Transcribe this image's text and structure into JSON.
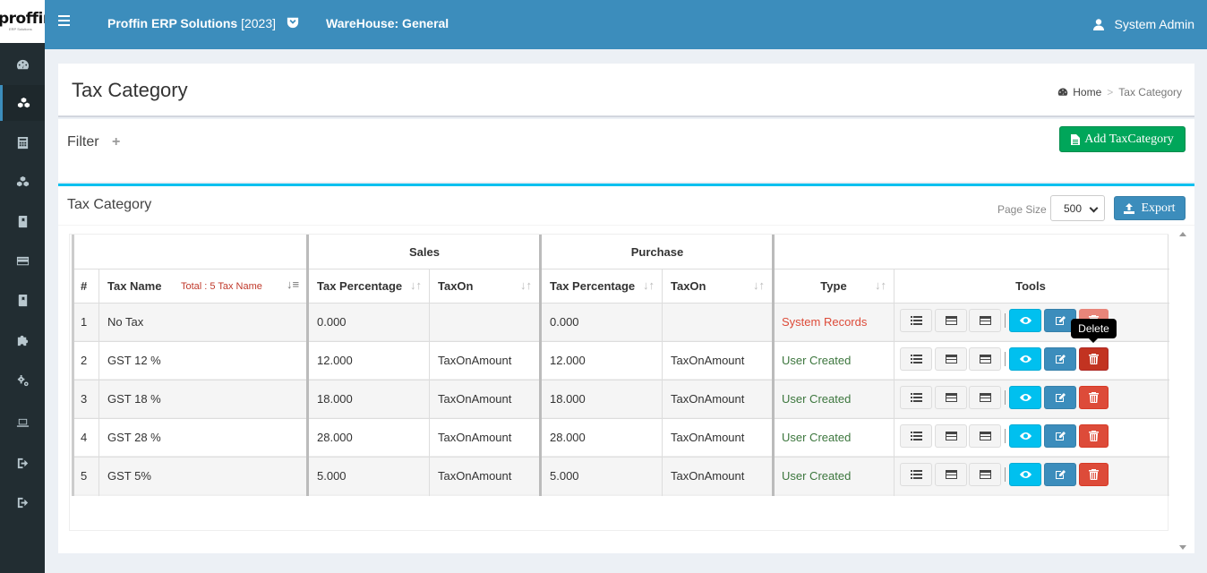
{
  "brand": {
    "logo_text": "proffin",
    "logo_sub": "ERP Solutions"
  },
  "topbar": {
    "app_title": "Proffin ERP Solutions",
    "app_year": "[2023]",
    "warehouse": "WareHouse: General",
    "user": "System Admin"
  },
  "sidebar": {
    "items": [
      {
        "icon": "dashboard-icon"
      },
      {
        "icon": "cubes-icon",
        "active": true
      },
      {
        "icon": "calculator-icon"
      },
      {
        "icon": "cubes-icon"
      },
      {
        "icon": "book-icon"
      },
      {
        "icon": "credit-card-icon"
      },
      {
        "icon": "book-icon"
      },
      {
        "icon": "puzzle-icon"
      },
      {
        "icon": "cogs-icon"
      },
      {
        "icon": "laptop-icon"
      },
      {
        "icon": "sign-out-icon"
      },
      {
        "icon": "sign-out-icon"
      }
    ]
  },
  "page": {
    "title": "Tax Category",
    "breadcrumb_home": "Home",
    "breadcrumb_sep": ">",
    "breadcrumb_current": "Tax Category"
  },
  "filter": {
    "title": "Filter",
    "toggle": "+",
    "add_button": "Add TaxCategory"
  },
  "table_panel": {
    "title": "Tax Category",
    "page_size_label": "Page Size",
    "page_size_value": "500",
    "export_button": "Export",
    "group_sales": "Sales",
    "group_purchase": "Purchase",
    "col_num": "#",
    "col_tax_name": "Tax Name",
    "total_label": "Total : 5 Tax Name",
    "col_sales_pct": "Tax Percentage",
    "col_sales_taxon": "TaxOn",
    "col_purchase_pct": "Tax Percentage",
    "col_purchase_taxon": "TaxOn",
    "col_type": "Type",
    "col_tools": "Tools",
    "tooltip": "Delete",
    "rows": [
      {
        "num": "1",
        "name": "No Tax",
        "sales_pct": "0.000",
        "sales_taxon": "",
        "purchase_pct": "0.000",
        "purchase_taxon": "",
        "type": "System Records"
      },
      {
        "num": "2",
        "name": "GST 12 %",
        "sales_pct": "12.000",
        "sales_taxon": "TaxOnAmount",
        "purchase_pct": "12.000",
        "purchase_taxon": "TaxOnAmount",
        "type": "User Created"
      },
      {
        "num": "3",
        "name": "GST 18 %",
        "sales_pct": "18.000",
        "sales_taxon": "TaxOnAmount",
        "purchase_pct": "18.000",
        "purchase_taxon": "TaxOnAmount",
        "type": "User Created"
      },
      {
        "num": "4",
        "name": "GST 28 %",
        "sales_pct": "28.000",
        "sales_taxon": "TaxOnAmount",
        "purchase_pct": "28.000",
        "purchase_taxon": "TaxOnAmount",
        "type": "User Created"
      },
      {
        "num": "5",
        "name": "GST 5%",
        "sales_pct": "5.000",
        "sales_taxon": "TaxOnAmount",
        "purchase_pct": "5.000",
        "purchase_taxon": "TaxOnAmount",
        "type": "User Created"
      }
    ]
  },
  "colors": {
    "topbar": "#3c8dbc",
    "sidebar": "#222d32",
    "success": "#00a65a",
    "info": "#00c0ef",
    "danger": "#dd4b39",
    "system_records": "#dd4b39",
    "user_created": "#3c763d"
  }
}
